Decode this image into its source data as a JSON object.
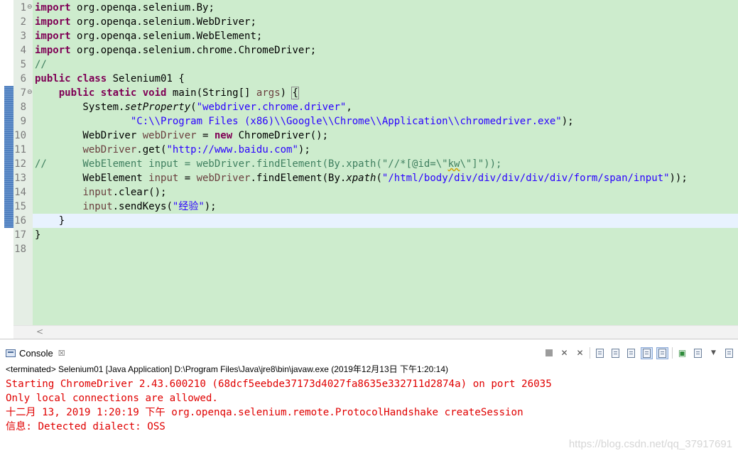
{
  "editor": {
    "lines": [
      {
        "n": "1",
        "fold": "⊖",
        "tokens": [
          {
            "t": "import",
            "c": "kw"
          },
          {
            "t": " org.openqa.selenium.By;"
          }
        ]
      },
      {
        "n": "2",
        "tokens": [
          {
            "t": "import",
            "c": "kw"
          },
          {
            "t": " org.openqa.selenium.WebDriver;"
          }
        ]
      },
      {
        "n": "3",
        "tokens": [
          {
            "t": "import",
            "c": "kw"
          },
          {
            "t": " org.openqa.selenium.WebElement;"
          }
        ]
      },
      {
        "n": "4",
        "tokens": [
          {
            "t": "import",
            "c": "kw"
          },
          {
            "t": " org.openqa.selenium.chrome.ChromeDriver;"
          }
        ]
      },
      {
        "n": "5",
        "tokens": [
          {
            "t": "//",
            "c": "cmt"
          }
        ]
      },
      {
        "n": "6",
        "tokens": [
          {
            "t": "public",
            "c": "kw"
          },
          {
            "t": " "
          },
          {
            "t": "class",
            "c": "kw"
          },
          {
            "t": " Selenium01 {"
          }
        ]
      },
      {
        "n": "7",
        "fold": "⊖",
        "tokens": [
          {
            "t": "    "
          },
          {
            "t": "public",
            "c": "kw"
          },
          {
            "t": " "
          },
          {
            "t": "static",
            "c": "kw"
          },
          {
            "t": " "
          },
          {
            "t": "void",
            "c": "kw"
          },
          {
            "t": " main(String[] "
          },
          {
            "t": "args",
            "c": "var"
          },
          {
            "t": ") "
          },
          {
            "t": "{",
            "c": "brace-hl"
          }
        ]
      },
      {
        "n": "8",
        "tokens": [
          {
            "t": "        System."
          },
          {
            "t": "setProperty",
            "c": "it"
          },
          {
            "t": "("
          },
          {
            "t": "\"webdriver.chrome.driver\"",
            "c": "str"
          },
          {
            "t": ","
          }
        ]
      },
      {
        "n": "9",
        "tokens": [
          {
            "t": "                "
          },
          {
            "t": "\"C:\\\\Program Files (x86)\\\\Google\\\\Chrome\\\\Application\\\\chromedriver.exe\"",
            "c": "str"
          },
          {
            "t": ");"
          }
        ]
      },
      {
        "n": "10",
        "tokens": [
          {
            "t": "        WebDriver "
          },
          {
            "t": "webDriver",
            "c": "var"
          },
          {
            "t": " = "
          },
          {
            "t": "new",
            "c": "kw"
          },
          {
            "t": " ChromeDriver();"
          }
        ]
      },
      {
        "n": "11",
        "tokens": [
          {
            "t": "        "
          },
          {
            "t": "webDriver",
            "c": "var"
          },
          {
            "t": ".get("
          },
          {
            "t": "\"http://www.baidu.com\"",
            "c": "str"
          },
          {
            "t": ");"
          }
        ]
      },
      {
        "n": "12",
        "tokens": [
          {
            "t": "//      WebElement input = webDriver.findElement(By.xpath(\"//*[@id=\\\"",
            "c": "cmt"
          },
          {
            "t": "kw",
            "c": "cmt squig"
          },
          {
            "t": "\\\"]\"));",
            "c": "cmt"
          }
        ]
      },
      {
        "n": "13",
        "tokens": [
          {
            "t": "        WebElement "
          },
          {
            "t": "input",
            "c": "var"
          },
          {
            "t": " = "
          },
          {
            "t": "webDriver",
            "c": "var"
          },
          {
            "t": ".findElement(By."
          },
          {
            "t": "xpath",
            "c": "it"
          },
          {
            "t": "("
          },
          {
            "t": "\"/html/body/div/div/div/div/div/form/span/input\"",
            "c": "str"
          },
          {
            "t": "));"
          }
        ]
      },
      {
        "n": "14",
        "tokens": [
          {
            "t": "        "
          },
          {
            "t": "input",
            "c": "var"
          },
          {
            "t": ".clear();"
          }
        ]
      },
      {
        "n": "15",
        "tokens": [
          {
            "t": "        "
          },
          {
            "t": "input",
            "c": "var"
          },
          {
            "t": ".sendKeys("
          },
          {
            "t": "\"经验\"",
            "c": "str"
          },
          {
            "t": ");"
          }
        ]
      },
      {
        "n": "16",
        "tokens": [
          {
            "t": "    }"
          }
        ]
      },
      {
        "n": "17",
        "tokens": [
          {
            "t": "}"
          }
        ]
      },
      {
        "n": "18",
        "tokens": []
      }
    ],
    "scroll_arrow": "<"
  },
  "console": {
    "tab_label": "Console",
    "tab_close": "☒",
    "status": "<terminated> Selenium01 [Java Application] D:\\Program Files\\Java\\jre8\\bin\\javaw.exe (2019年12月13日 下午1:20:14)",
    "output": [
      "Starting ChromeDriver 2.43.600210 (68dcf5eebde37173d4027fa8635e332711d2874a) on port 26035",
      "Only local connections are allowed.",
      "十二月 13, 2019 1:20:19 下午 org.openqa.selenium.remote.ProtocolHandshake createSession",
      "信息: Detected dialect: OSS"
    ]
  },
  "watermark": "https://blog.csdn.net/qq_37917691"
}
